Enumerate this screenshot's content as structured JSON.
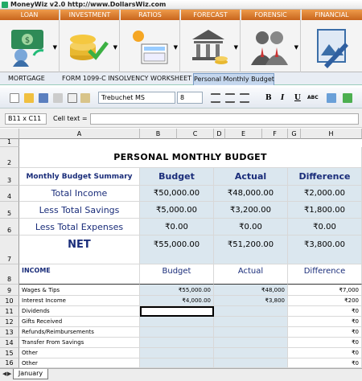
{
  "app": {
    "title": "MoneyWiz v2.0   http://www.DollarsWiz.com"
  },
  "ribbon": [
    {
      "label": "LOAN",
      "icon": "money-exchange-icon"
    },
    {
      "label": "INVESTMENT",
      "icon": "coins-checkmark-icon"
    },
    {
      "label": "RATIOS",
      "icon": "calculator-sun-icon"
    },
    {
      "label": "FORECAST",
      "icon": "bank-building-icon"
    },
    {
      "label": "FORENSIC",
      "icon": "people-icon"
    },
    {
      "label": "FINANCIAL",
      "icon": "picture-pen-icon"
    }
  ],
  "tabs": [
    "MORTGAGE",
    "FORM 1099-C INSOLVENCY WORKSHEET",
    "Personal Monthly Budget"
  ],
  "toolbar": {
    "font": "Trebuchet MS",
    "size": "8",
    "bold": "B",
    "italic": "I",
    "underline": "U",
    "abc": "ABC"
  },
  "formula": {
    "cell_ref": "B11 x C11",
    "cell_text_label": "Cell text ="
  },
  "columns": [
    "A",
    "B",
    "C",
    "D",
    "E",
    "F",
    "G",
    "H"
  ],
  "rows": [
    "1",
    "2",
    "3",
    "4",
    "5",
    "6",
    "7",
    "8",
    "9",
    "10",
    "11",
    "12",
    "13",
    "14",
    "15",
    "16"
  ],
  "sheet": {
    "title": "PERSONAL MONTHLY BUDGET",
    "summary_title": "Monthly Budget Summary",
    "h_budget": "Budget",
    "h_actual": "Actual",
    "h_difference": "Difference",
    "summary": [
      {
        "label": "Total Income",
        "budget": "₹50,000.00",
        "actual": "₹48,000.00",
        "diff": "₹2,000.00"
      },
      {
        "label": "Less Total Savings",
        "budget": "₹5,000.00",
        "actual": "₹3,200.00",
        "diff": "₹1,800.00"
      },
      {
        "label": "Less Total Expenses",
        "budget": "₹0.00",
        "actual": "₹0.00",
        "diff": "₹0.00"
      },
      {
        "label": "NET",
        "budget": "₹55,000.00",
        "actual": "₹51,200.00",
        "diff": "₹3,800.00"
      }
    ],
    "income_title": "INCOME",
    "income": [
      {
        "label": "Wages & Tips",
        "budget": "₹55,000.00",
        "actual": "₹48,000",
        "diff": "₹7,000"
      },
      {
        "label": "Interest Income",
        "budget": "₹4,000.00",
        "actual": "₹3,800",
        "diff": "₹200"
      },
      {
        "label": "Dividends",
        "budget": "",
        "actual": "",
        "diff": "₹0"
      },
      {
        "label": "Gifts Received",
        "budget": "",
        "actual": "",
        "diff": "₹0"
      },
      {
        "label": "Refunds/Reimbursements",
        "budget": "",
        "actual": "",
        "diff": "₹0"
      },
      {
        "label": "Transfer From Savings",
        "budget": "",
        "actual": "",
        "diff": "₹0"
      },
      {
        "label": "Other",
        "budget": "",
        "actual": "",
        "diff": "₹0"
      },
      {
        "label": "Other",
        "budget": "",
        "actual": "",
        "diff": "₹0"
      }
    ]
  },
  "sheet_tab": "January"
}
